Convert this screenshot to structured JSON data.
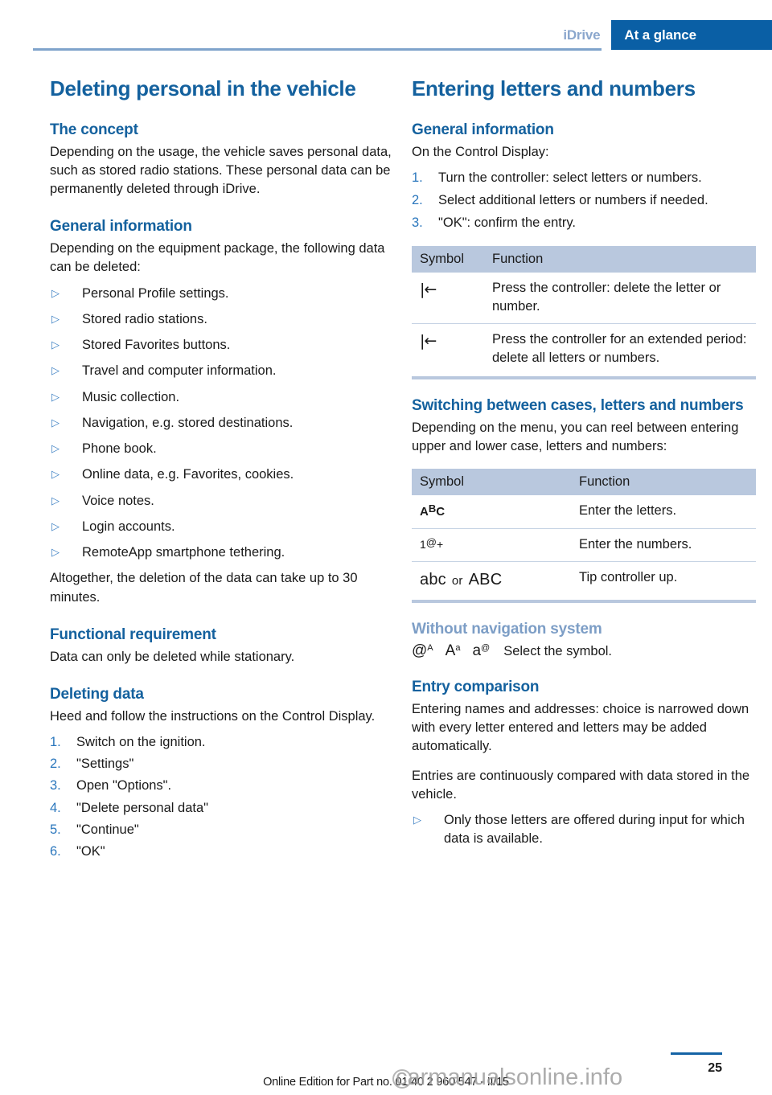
{
  "header": {
    "breadcrumb_inactive": "iDrive",
    "breadcrumb_active": "At a glance"
  },
  "left_column": {
    "title": "Deleting personal in the vehicle",
    "sections": [
      {
        "heading": "The concept",
        "paragraph": "Depending on the usage, the vehicle saves personal data, such as stored radio stations. These personal data can be permanently deleted through iDrive."
      },
      {
        "heading": "General information",
        "paragraph": "Depending on the equipment package, the following data can be deleted:",
        "bullets": [
          "Personal Profile settings.",
          "Stored radio stations.",
          "Stored Favorites buttons.",
          "Travel and computer information.",
          "Music collection.",
          "Navigation, e.g. stored destinations.",
          "Phone book.",
          "Online data, e.g. Favorites, cookies.",
          "Voice notes.",
          "Login accounts.",
          "RemoteApp smartphone tethering."
        ],
        "closing_paragraph": "Altogether, the deletion of the data can take up to 30 minutes."
      },
      {
        "heading": "Functional requirement",
        "paragraph": "Data can only be deleted while stationary."
      },
      {
        "heading": "Deleting data",
        "paragraph": "Heed and follow the instructions on the Control Display.",
        "steps": [
          {
            "number": "1.",
            "text": "Switch on the ignition."
          },
          {
            "number": "2.",
            "text": "\"Settings\""
          },
          {
            "number": "3.",
            "text": "Open \"Options\"."
          },
          {
            "number": "4.",
            "text": "\"Delete personal data\""
          },
          {
            "number": "5.",
            "text": "\"Continue\""
          },
          {
            "number": "6.",
            "text": "\"OK\""
          }
        ]
      }
    ]
  },
  "right_column": {
    "title": "Entering letters and numbers",
    "general_information": {
      "heading": "General information",
      "paragraph": "On the Control Display:",
      "steps": [
        {
          "number": "1.",
          "text": "Turn the controller: select letters or numbers."
        },
        {
          "number": "2.",
          "text": "Select additional letters or numbers if needed."
        },
        {
          "number": "3.",
          "text": "\"OK\": confirm the entry."
        }
      ]
    },
    "table_delete": {
      "columns": [
        "Symbol",
        "Function"
      ],
      "rows": [
        {
          "symbol": "|←",
          "symbol_name": "backspace-icon",
          "function": "Press the controller: delete the letter or number."
        },
        {
          "symbol": "|←",
          "symbol_name": "backspace-icon",
          "function": "Press the controller for an extended period: delete all letters or numbers."
        }
      ]
    },
    "switching_cases": {
      "heading": "Switching between cases, letters and numbers",
      "paragraph": "Depending on the menu, you can reel between entering upper and lower case, letters and numbers:"
    },
    "table_cases": {
      "columns": [
        "Symbol",
        "Function"
      ],
      "rows": [
        {
          "symbol_base": "A",
          "symbol_sup": "B",
          "symbol_tail": "C",
          "symbol_name": "abc-letters-icon",
          "function": "Enter the letters."
        },
        {
          "symbol_base": "1",
          "symbol_sup": "@",
          "symbol_tail": "+",
          "symbol_name": "numbers-symbols-icon",
          "function": "Enter the numbers."
        },
        {
          "symbol_lower": "abc",
          "symbol_or": "or",
          "symbol_upper": "ABC",
          "symbol_name": "case-toggle-icon",
          "function": "Tip controller up."
        }
      ]
    },
    "without_navigation": {
      "heading": "Without navigation system",
      "symbols": [
        {
          "base": "@",
          "sup": "A",
          "name": "at-upper-a-icon"
        },
        {
          "base": "A",
          "sup": "a",
          "name": "upper-a-lower-a-icon"
        },
        {
          "base": "a",
          "sup": "@",
          "name": "lower-a-at-icon"
        }
      ],
      "text": "Select the symbol."
    },
    "entry_comparison": {
      "heading": "Entry comparison",
      "paragraph1": "Entering names and addresses: choice is narrowed down with every letter entered and letters may be added automatically.",
      "paragraph2": "Entries are continuously compared with data stored in the vehicle.",
      "bullets": [
        "Only those letters are offered during input for which data is available."
      ]
    }
  },
  "footer": {
    "note": "Online Edition for Part no. 01 40 2 960 547 - II/15",
    "page_number": "25",
    "watermark": "carmanualsonline.info"
  },
  "colors": {
    "brand_blue": "#14619e",
    "banner_blue": "#0a5fa5",
    "muted_blue": "#8ba7cd",
    "table_header": "#b9c8de"
  }
}
